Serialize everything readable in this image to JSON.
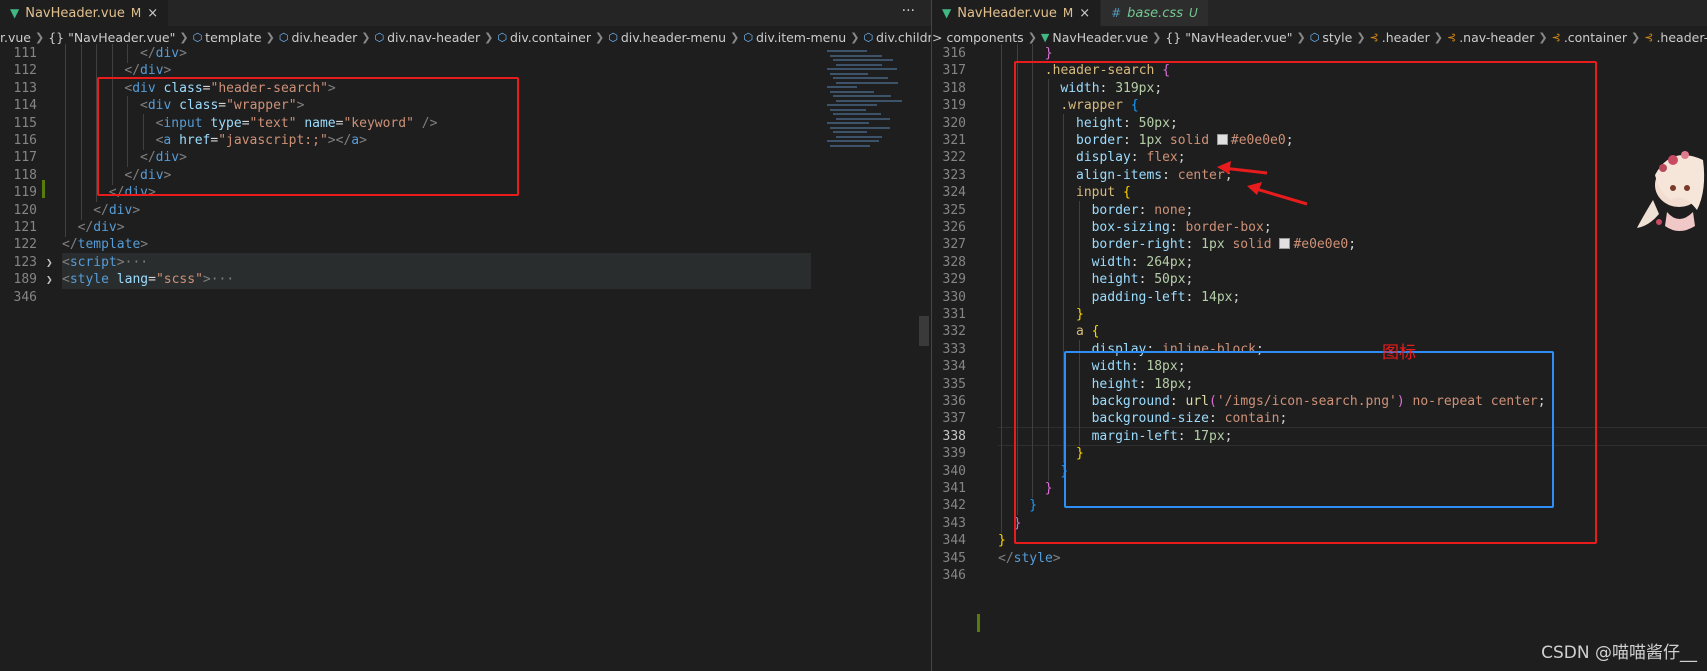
{
  "left": {
    "tabs": [
      {
        "name": "NavHeader.vue",
        "status": "M",
        "close": "×",
        "icon": "vue-icon",
        "active": true
      }
    ],
    "more": "···",
    "breadcrumbs": [
      {
        "label": "r.vue",
        "icon": ""
      },
      {
        "label": "{} \"NavHeader.vue\"",
        "icon": ""
      },
      {
        "label": "template",
        "icon": "cube-icon"
      },
      {
        "label": "div.header",
        "icon": "cube-icon"
      },
      {
        "label": "div.nav-header",
        "icon": "cube-icon"
      },
      {
        "label": "div.container",
        "icon": "cube-icon"
      },
      {
        "label": "div.header-menu",
        "icon": "cube-icon"
      },
      {
        "label": "div.item-menu",
        "icon": "cube-icon"
      },
      {
        "label": "div.children",
        "icon": "cube-icon"
      }
    ],
    "lines": [
      {
        "n": "111",
        "indent": 6,
        "text": [
          {
            "t": "</",
            "c": "t-punc"
          },
          {
            "t": "div",
            "c": "t-tag"
          },
          {
            "t": ">",
            "c": "t-punc"
          }
        ]
      },
      {
        "n": "112",
        "indent": 5,
        "text": [
          {
            "t": "</",
            "c": "t-punc"
          },
          {
            "t": "div",
            "c": "t-tag"
          },
          {
            "t": ">",
            "c": "t-punc"
          }
        ]
      },
      {
        "n": "113",
        "indent": 5,
        "text": [
          {
            "t": "<",
            "c": "t-punc"
          },
          {
            "t": "div",
            "c": "t-tag"
          },
          {
            "t": " class",
            "c": "t-attr"
          },
          {
            "t": "=",
            "c": "t-plain"
          },
          {
            "t": "\"header-search\"",
            "c": "t-str"
          },
          {
            "t": ">",
            "c": "t-punc"
          }
        ]
      },
      {
        "n": "114",
        "indent": 6,
        "text": [
          {
            "t": "<",
            "c": "t-punc"
          },
          {
            "t": "div",
            "c": "t-tag"
          },
          {
            "t": " class",
            "c": "t-attr"
          },
          {
            "t": "=",
            "c": "t-plain"
          },
          {
            "t": "\"wrapper\"",
            "c": "t-str"
          },
          {
            "t": ">",
            "c": "t-punc"
          }
        ]
      },
      {
        "n": "115",
        "indent": 7,
        "text": [
          {
            "t": "<",
            "c": "t-punc"
          },
          {
            "t": "input",
            "c": "t-tag"
          },
          {
            "t": " type",
            "c": "t-attr"
          },
          {
            "t": "=",
            "c": "t-plain"
          },
          {
            "t": "\"text\"",
            "c": "t-str"
          },
          {
            "t": " name",
            "c": "t-attr"
          },
          {
            "t": "=",
            "c": "t-plain"
          },
          {
            "t": "\"keyword\"",
            "c": "t-str"
          },
          {
            "t": " />",
            "c": "t-punc"
          }
        ]
      },
      {
        "n": "116",
        "indent": 7,
        "text": [
          {
            "t": "<",
            "c": "t-punc"
          },
          {
            "t": "a",
            "c": "t-tag"
          },
          {
            "t": " href",
            "c": "t-attr"
          },
          {
            "t": "=",
            "c": "t-plain"
          },
          {
            "t": "\"javascript:;\"",
            "c": "t-str"
          },
          {
            "t": "></",
            "c": "t-punc"
          },
          {
            "t": "a",
            "c": "t-tag"
          },
          {
            "t": ">",
            "c": "t-punc"
          }
        ]
      },
      {
        "n": "117",
        "indent": 6,
        "text": [
          {
            "t": "</",
            "c": "t-punc"
          },
          {
            "t": "div",
            "c": "t-tag"
          },
          {
            "t": ">",
            "c": "t-punc"
          }
        ]
      },
      {
        "n": "118",
        "indent": 5,
        "text": [
          {
            "t": "</",
            "c": "t-punc"
          },
          {
            "t": "div",
            "c": "t-tag"
          },
          {
            "t": ">",
            "c": "t-punc"
          }
        ]
      },
      {
        "n": "119",
        "indent": 4,
        "text": [
          {
            "t": "</",
            "c": "t-punc"
          },
          {
            "t": "div",
            "c": "t-tag"
          },
          {
            "t": ">",
            "c": "t-punc"
          }
        ]
      },
      {
        "n": "120",
        "indent": 3,
        "text": [
          {
            "t": "</",
            "c": "t-punc"
          },
          {
            "t": "div",
            "c": "t-tag"
          },
          {
            "t": ">",
            "c": "t-punc"
          }
        ]
      },
      {
        "n": "121",
        "indent": 2,
        "text": [
          {
            "t": "</",
            "c": "t-punc"
          },
          {
            "t": "div",
            "c": "t-tag"
          },
          {
            "t": ">",
            "c": "t-punc"
          }
        ]
      },
      {
        "n": "122",
        "indent": 1,
        "text": [
          {
            "t": "</",
            "c": "t-punc"
          },
          {
            "t": "template",
            "c": "t-tag"
          },
          {
            "t": ">",
            "c": "t-punc"
          }
        ]
      },
      {
        "n": "123",
        "indent": 1,
        "folded": true,
        "text": [
          {
            "t": "<",
            "c": "t-punc"
          },
          {
            "t": "script",
            "c": "t-tag"
          },
          {
            "t": ">",
            "c": "t-punc"
          },
          {
            "t": "···",
            "c": "t-punc"
          }
        ]
      },
      {
        "n": "189",
        "indent": 1,
        "folded": true,
        "text": [
          {
            "t": "<",
            "c": "t-punc"
          },
          {
            "t": "style",
            "c": "t-tag"
          },
          {
            "t": " lang",
            "c": "t-attr"
          },
          {
            "t": "=",
            "c": "t-plain"
          },
          {
            "t": "\"scss\"",
            "c": "t-str"
          },
          {
            "t": ">",
            "c": "t-punc"
          },
          {
            "t": "···",
            "c": "t-punc"
          }
        ]
      },
      {
        "n": "346",
        "indent": 0,
        "text": []
      }
    ]
  },
  "right": {
    "tabs": [
      {
        "name": "NavHeader.vue",
        "status": "M",
        "close": "×",
        "icon": "vue-icon",
        "active": true
      },
      {
        "name": "base.css",
        "status": "U",
        "close": "",
        "icon": "css-hash-icon",
        "active": false
      }
    ],
    "breadcrumbs": [
      {
        "label": "> components",
        "icon": ""
      },
      {
        "label": "NavHeader.vue",
        "icon": "vue-icon"
      },
      {
        "label": "{} \"NavHeader.vue\"",
        "icon": ""
      },
      {
        "label": "style",
        "icon": "cube-icon"
      },
      {
        "label": ".header",
        "icon": "selector-icon"
      },
      {
        "label": ".nav-header",
        "icon": "selector-icon"
      },
      {
        "label": ".container",
        "icon": "selector-icon"
      },
      {
        "label": ".header-se",
        "icon": "selector-icon"
      }
    ],
    "lines": [
      {
        "n": "316",
        "indent": 4,
        "text": [
          {
            "t": "}",
            "c": "b2"
          }
        ]
      },
      {
        "n": "317",
        "indent": 4,
        "text": [
          {
            "t": ".header-search ",
            "c": "t-sel"
          },
          {
            "t": "{",
            "c": "b2"
          }
        ]
      },
      {
        "n": "318",
        "indent": 5,
        "text": [
          {
            "t": "width",
            "c": "t-prop"
          },
          {
            "t": ": ",
            "c": "t-plain"
          },
          {
            "t": "319px",
            "c": "t-num"
          },
          {
            "t": ";",
            "c": "t-plain"
          }
        ]
      },
      {
        "n": "319",
        "indent": 5,
        "text": [
          {
            "t": ".wrapper ",
            "c": "t-sel"
          },
          {
            "t": "{",
            "c": "b3"
          }
        ]
      },
      {
        "n": "320",
        "indent": 6,
        "text": [
          {
            "t": "height",
            "c": "t-prop"
          },
          {
            "t": ": ",
            "c": "t-plain"
          },
          {
            "t": "50px",
            "c": "t-num"
          },
          {
            "t": ";",
            "c": "t-plain"
          }
        ]
      },
      {
        "n": "321",
        "indent": 6,
        "text": [
          {
            "t": "border",
            "c": "t-prop"
          },
          {
            "t": ": ",
            "c": "t-plain"
          },
          {
            "t": "1px",
            "c": "t-num"
          },
          {
            "t": " solid ",
            "c": "t-val"
          },
          {
            "t": "SWATCH",
            "c": "swatch"
          },
          {
            "t": "#e0e0e0",
            "c": "t-val"
          },
          {
            "t": ";",
            "c": "t-plain"
          }
        ]
      },
      {
        "n": "322",
        "indent": 6,
        "text": [
          {
            "t": "display",
            "c": "t-prop"
          },
          {
            "t": ": ",
            "c": "t-plain"
          },
          {
            "t": "flex",
            "c": "t-val"
          },
          {
            "t": ";",
            "c": "t-plain"
          }
        ]
      },
      {
        "n": "323",
        "indent": 6,
        "text": [
          {
            "t": "align-items",
            "c": "t-prop"
          },
          {
            "t": ": ",
            "c": "t-plain"
          },
          {
            "t": "center",
            "c": "t-val"
          },
          {
            "t": ";",
            "c": "t-plain"
          }
        ]
      },
      {
        "n": "324",
        "indent": 6,
        "text": [
          {
            "t": "input ",
            "c": "t-sel"
          },
          {
            "t": "{",
            "c": "b1"
          }
        ]
      },
      {
        "n": "325",
        "indent": 7,
        "text": [
          {
            "t": "border",
            "c": "t-prop"
          },
          {
            "t": ": ",
            "c": "t-plain"
          },
          {
            "t": "none",
            "c": "t-val"
          },
          {
            "t": ";",
            "c": "t-plain"
          }
        ]
      },
      {
        "n": "326",
        "indent": 7,
        "text": [
          {
            "t": "box-sizing",
            "c": "t-prop"
          },
          {
            "t": ": ",
            "c": "t-plain"
          },
          {
            "t": "border-box",
            "c": "t-val"
          },
          {
            "t": ";",
            "c": "t-plain"
          }
        ]
      },
      {
        "n": "327",
        "indent": 7,
        "text": [
          {
            "t": "border-right",
            "c": "t-prop"
          },
          {
            "t": ": ",
            "c": "t-plain"
          },
          {
            "t": "1px",
            "c": "t-num"
          },
          {
            "t": " solid ",
            "c": "t-val"
          },
          {
            "t": "SWATCH",
            "c": "swatch"
          },
          {
            "t": "#e0e0e0",
            "c": "t-val"
          },
          {
            "t": ";",
            "c": "t-plain"
          }
        ]
      },
      {
        "n": "328",
        "indent": 7,
        "text": [
          {
            "t": "width",
            "c": "t-prop"
          },
          {
            "t": ": ",
            "c": "t-plain"
          },
          {
            "t": "264px",
            "c": "t-num"
          },
          {
            "t": ";",
            "c": "t-plain"
          }
        ]
      },
      {
        "n": "329",
        "indent": 7,
        "text": [
          {
            "t": "height",
            "c": "t-prop"
          },
          {
            "t": ": ",
            "c": "t-plain"
          },
          {
            "t": "50px",
            "c": "t-num"
          },
          {
            "t": ";",
            "c": "t-plain"
          }
        ]
      },
      {
        "n": "330",
        "indent": 7,
        "text": [
          {
            "t": "padding-left",
            "c": "t-prop"
          },
          {
            "t": ": ",
            "c": "t-plain"
          },
          {
            "t": "14px",
            "c": "t-num"
          },
          {
            "t": ";",
            "c": "t-plain"
          }
        ]
      },
      {
        "n": "331",
        "indent": 6,
        "text": [
          {
            "t": "}",
            "c": "b1"
          }
        ]
      },
      {
        "n": "332",
        "indent": 6,
        "text": [
          {
            "t": "a ",
            "c": "t-sel"
          },
          {
            "t": "{",
            "c": "b1"
          }
        ]
      },
      {
        "n": "333",
        "indent": 7,
        "text": [
          {
            "t": "display",
            "c": "t-prop"
          },
          {
            "t": ": ",
            "c": "t-plain"
          },
          {
            "t": "inline-block",
            "c": "t-val"
          },
          {
            "t": ";",
            "c": "t-plain"
          }
        ]
      },
      {
        "n": "334",
        "indent": 7,
        "text": [
          {
            "t": "width",
            "c": "t-prop"
          },
          {
            "t": ": ",
            "c": "t-plain"
          },
          {
            "t": "18px",
            "c": "t-num"
          },
          {
            "t": ";",
            "c": "t-plain"
          }
        ]
      },
      {
        "n": "335",
        "indent": 7,
        "text": [
          {
            "t": "height",
            "c": "t-prop"
          },
          {
            "t": ": ",
            "c": "t-plain"
          },
          {
            "t": "18px",
            "c": "t-num"
          },
          {
            "t": ";",
            "c": "t-plain"
          }
        ]
      },
      {
        "n": "336",
        "indent": 7,
        "text": [
          {
            "t": "background",
            "c": "t-prop"
          },
          {
            "t": ": ",
            "c": "t-plain"
          },
          {
            "t": "url",
            "c": "t-fn"
          },
          {
            "t": "(",
            "c": "b2"
          },
          {
            "t": "'/imgs/icon-search.png'",
            "c": "t-str"
          },
          {
            "t": ")",
            "c": "b2"
          },
          {
            "t": " no-repeat center",
            "c": "t-val"
          },
          {
            "t": ";",
            "c": "t-plain"
          }
        ]
      },
      {
        "n": "337",
        "indent": 7,
        "text": [
          {
            "t": "background-size",
            "c": "t-prop"
          },
          {
            "t": ": ",
            "c": "t-plain"
          },
          {
            "t": "contain",
            "c": "t-val"
          },
          {
            "t": ";",
            "c": "t-plain"
          }
        ]
      },
      {
        "n": "338",
        "indent": 7,
        "current": true,
        "text": [
          {
            "t": "margin-left",
            "c": "t-prop"
          },
          {
            "t": ": ",
            "c": "t-plain"
          },
          {
            "t": "17px",
            "c": "t-num"
          },
          {
            "t": ";",
            "c": "t-plain"
          }
        ]
      },
      {
        "n": "339",
        "indent": 6,
        "text": [
          {
            "t": "}",
            "c": "b1"
          }
        ]
      },
      {
        "n": "340",
        "indent": 5,
        "text": [
          {
            "t": "}",
            "c": "b3"
          }
        ]
      },
      {
        "n": "341",
        "indent": 4,
        "text": [
          {
            "t": "}",
            "c": "b2"
          }
        ]
      },
      {
        "n": "342",
        "indent": 3,
        "text": [
          {
            "t": "}",
            "c": "b3"
          }
        ]
      },
      {
        "n": "343",
        "indent": 2,
        "text": [
          {
            "t": "}",
            "c": "b2"
          }
        ]
      },
      {
        "n": "344",
        "indent": 1,
        "text": [
          {
            "t": "}",
            "c": "b1"
          }
        ]
      },
      {
        "n": "345",
        "indent": 1,
        "text": [
          {
            "t": "</",
            "c": "t-punc"
          },
          {
            "t": "style",
            "c": "t-tag"
          },
          {
            "t": ">",
            "c": "t-punc"
          }
        ]
      },
      {
        "n": "346",
        "indent": 0,
        "text": []
      }
    ],
    "annotation": "图标"
  },
  "watermark": "CSDN @喵喵酱仔__",
  "colors": {
    "highlight_red": "#e81c1c",
    "highlight_blue": "#2d8ef5",
    "modified": "#e2c08d",
    "untracked": "#73c991"
  }
}
